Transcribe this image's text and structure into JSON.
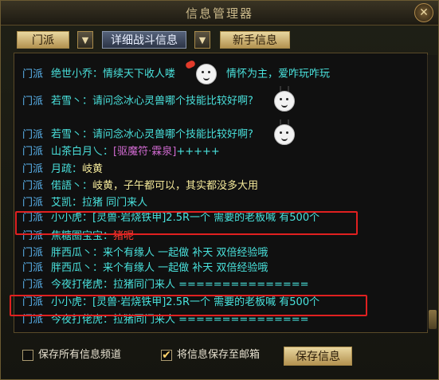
{
  "window": {
    "title": "信息管理器",
    "close_glyph": "✕"
  },
  "toolbar": {
    "channel_label": "门派",
    "dropdown_glyph": "▼",
    "combat_info_label": "详细战斗信息",
    "newbie_info_label": "新手信息"
  },
  "messages": [
    {
      "channel": "门派",
      "name": "绝世小乔",
      "text": "：情续天下收人喽",
      "extra": "情怀为主，爱咋玩咋玩",
      "emoji": "bow-face"
    },
    {
      "channel": "门派",
      "name": "若雪丶",
      "text": "：请问念冰心灵兽哪个技能比较好啊?",
      "emoji": "antenna-face"
    },
    {
      "channel": "门派",
      "name": "若雪丶",
      "text": "：请问念冰心灵兽哪个技能比较好啊?",
      "emoji": "antenna-face"
    },
    {
      "channel": "门派",
      "name": "山茶白月乀",
      "text": "：",
      "item": "[驱魔符·霖泉]",
      "extra": "+++++"
    },
    {
      "channel": "门派",
      "name": "月疏",
      "text": "：",
      "extra": "岐黄"
    },
    {
      "channel": "门派",
      "name": "偌語丶",
      "text": "：",
      "extra": "岐黄，子午都可以，其实都没多大用"
    },
    {
      "channel": "门派",
      "name": "艾凯",
      "text": "：拉猪 同门来人"
    },
    {
      "channel": "门派",
      "name": "小小虎",
      "text": "：[灵兽·岩烧铁甲]2.5R一个  需要的老板喊  有500个",
      "highlight": true
    },
    {
      "channel": "门派",
      "name": "焦糖圈宝宝",
      "text": "：",
      "red": "猪呢"
    },
    {
      "channel": "门派",
      "name": "胖西瓜丶",
      "text": "：来个有缘人 一起做 补天 双倍经验哦"
    },
    {
      "channel": "门派",
      "name": "胖西瓜丶",
      "text": "：来个有缘人 一起做 补天 双倍经验哦"
    },
    {
      "channel": "门派",
      "name": "今夜打佬虎",
      "text": "：拉猪同门来人  ==============="
    },
    {
      "channel": "门派",
      "name": "小小虎",
      "text": "：[灵兽·岩烧铁甲]2.5R一个  需要的老板喊  有500个",
      "highlight": true
    },
    {
      "channel": "门派",
      "name": "今夜打佬虎",
      "text": "：拉猪同门来人  ==============="
    }
  ],
  "footer": {
    "save_all_channels_label": "保存所有信息频道",
    "save_all_checked": false,
    "save_to_mail_label": "将信息保存至邮箱",
    "save_to_mail_checked": true,
    "save_button_label": "保存信息",
    "check_glyph": "✔"
  },
  "colors": {
    "highlight_border": "#e02020",
    "channel": "#5bb5f0",
    "name": "#49e1dc",
    "item": "#d06ad0",
    "warning": "#ff3b30"
  }
}
